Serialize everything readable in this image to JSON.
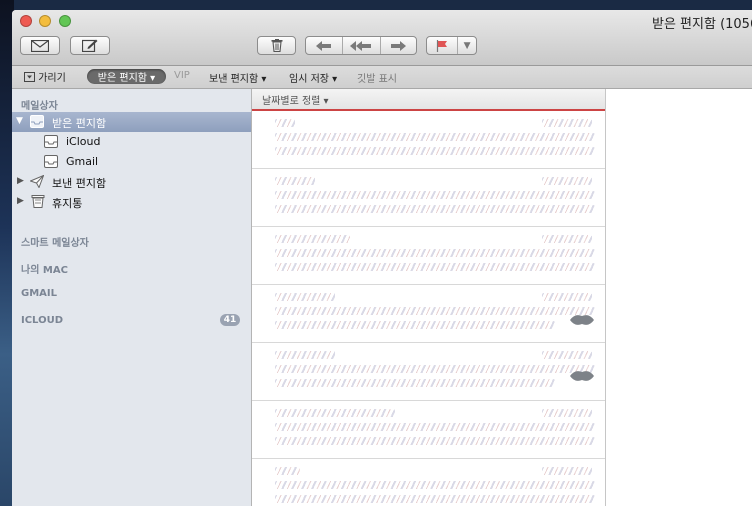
{
  "window": {
    "title": "받은 편지함 (1056"
  },
  "toolbar": {
    "get_mail_icon": "envelope-icon",
    "compose_icon": "compose-icon",
    "delete_icon": "trash-icon",
    "flag_icon": "flag-icon"
  },
  "favorites": {
    "hide": "가리기",
    "inbox": "받은 편지함 ▾",
    "vip": "VIP",
    "sent": "보낸 편지함 ▾",
    "drafts": "임시 저장 ▾",
    "flagged": "깃발 표시"
  },
  "sidebar": {
    "mailboxes_header": "메일상자",
    "items": [
      {
        "label": "받은 편지함"
      },
      {
        "label": "iCloud"
      },
      {
        "label": "Gmail"
      },
      {
        "label": "보낸 편지함"
      },
      {
        "label": "휴지통"
      }
    ],
    "smart_header": "스마트 메일상자",
    "mac_header": "나의 MAC",
    "gmail_header": "GMAIL",
    "icloud_header": "ICLOUD",
    "icloud_badge": "41"
  },
  "message_list": {
    "sort_label": "날짜별로 정렬 ▾"
  },
  "colors": {
    "selection": "#8e9fbd",
    "sort_underline": "#cc4444"
  }
}
